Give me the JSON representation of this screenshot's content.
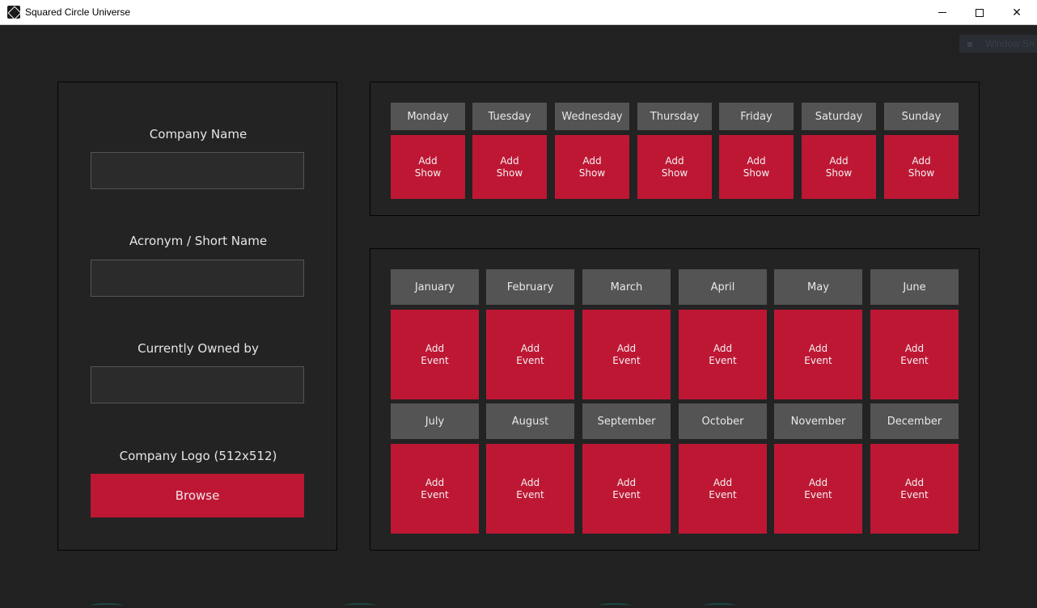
{
  "window": {
    "title": "Squared Circle Universe",
    "minimize": "—",
    "close": "✕",
    "overlay_chip": "Window Sn"
  },
  "company_form": {
    "name_label": "Company Name",
    "name_value": "",
    "acronym_label": "Acronym / Short Name",
    "acronym_value": "",
    "owner_label": "Currently Owned by",
    "owner_value": "",
    "logo_label": "Company Logo (512x512)",
    "browse_label": "Browse"
  },
  "weekly": {
    "days": [
      "Monday",
      "Tuesday",
      "Wednesday",
      "Thursday",
      "Friday",
      "Saturday",
      "Sunday"
    ],
    "add_line1": "Add",
    "add_line2": "Show"
  },
  "yearly": {
    "months": [
      "January",
      "February",
      "March",
      "April",
      "May",
      "June",
      "July",
      "August",
      "September",
      "October",
      "November",
      "December"
    ],
    "add_line1": "Add",
    "add_line2": "Event"
  },
  "colors": {
    "background": "#212121",
    "accent_red": "#be1734",
    "header_gray": "#545454"
  }
}
